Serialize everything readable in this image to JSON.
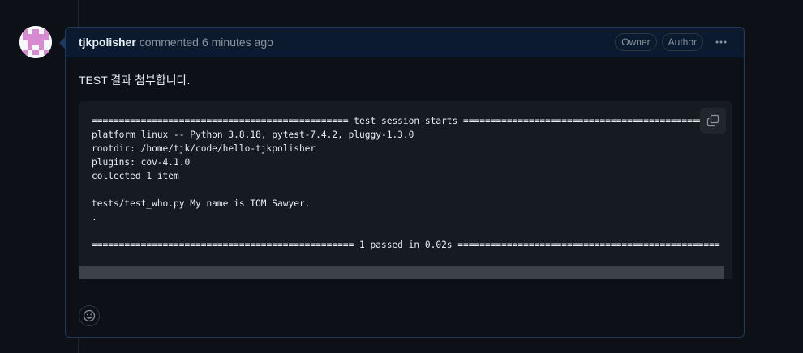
{
  "comment": {
    "author": "tjkpolisher",
    "action": "commented",
    "time": "6 minutes ago",
    "badges": [
      "Owner",
      "Author"
    ],
    "body_text": "TEST 결과 첨부합니다.",
    "code_lines": [
      "=============================================== test session starts ===============================================",
      "platform linux -- Python 3.8.18, pytest-7.4.2, pluggy-1.3.0",
      "rootdir: /home/tjk/code/hello-tjkpolisher",
      "plugins: cov-4.1.0",
      "collected 1 item",
      "",
      "tests/test_who.py My name is TOM Sawyer.",
      ".",
      "",
      "================================================ 1 passed in 0.02s ================================================"
    ]
  },
  "icons": {
    "copy": "copy-icon",
    "kebab": "kebab-horizontal-icon",
    "reaction": "smiley-icon"
  },
  "colors": {
    "background": "#0d1117",
    "border_accent": "#1f3a5f",
    "code_bg": "#161b22",
    "muted_text": "#8b949e"
  }
}
